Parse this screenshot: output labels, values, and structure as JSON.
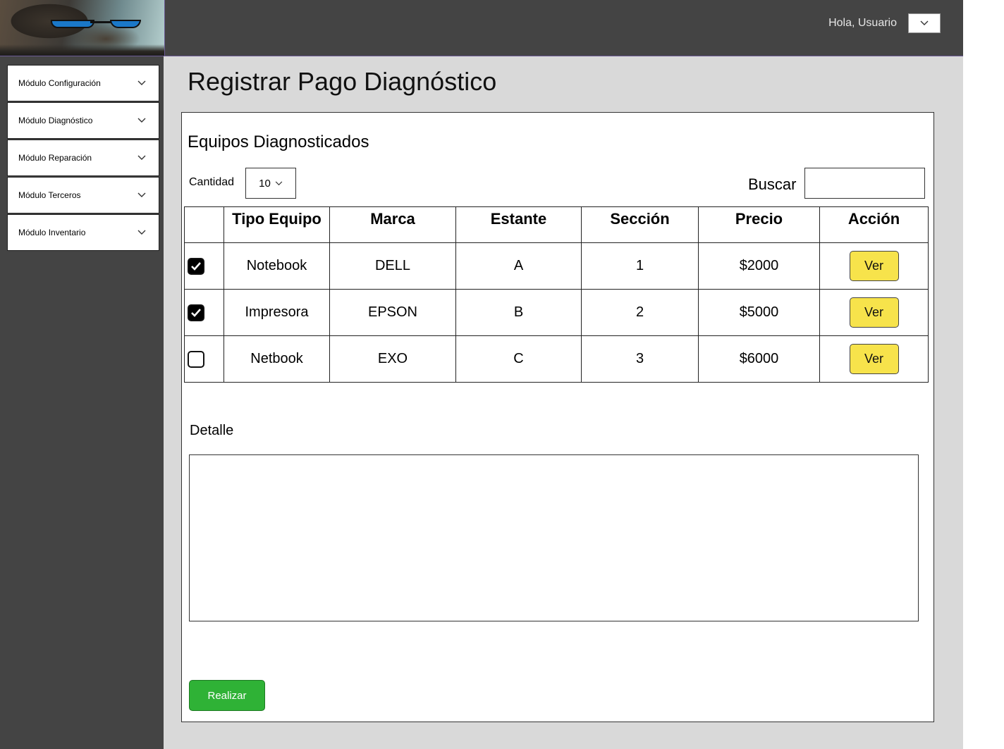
{
  "header": {
    "greeting": "Hola, Usuario"
  },
  "sidebar": {
    "items": [
      {
        "label": "Módulo Configuración"
      },
      {
        "label": "Módulo Diagnóstico"
      },
      {
        "label": "Módulo Reparación"
      },
      {
        "label": "Módulo Terceros"
      },
      {
        "label": "Módulo Inventario"
      }
    ]
  },
  "main": {
    "title": "Registrar Pago Diagnóstico",
    "section_title": "Equipos Diagnosticados",
    "quantity_label": "Cantidad",
    "quantity_value": "10",
    "search_label": "Buscar",
    "search_value": "",
    "table": {
      "headers": [
        "",
        "Tipo Equipo",
        "Marca",
        "Estante",
        "Sección",
        "Precio",
        "Acción"
      ],
      "rows": [
        {
          "checked": true,
          "tipo": "Notebook",
          "marca": "DELL",
          "estante": "A",
          "seccion": "1",
          "precio": "$2000",
          "accion": "Ver"
        },
        {
          "checked": true,
          "tipo": "Impresora",
          "marca": "EPSON",
          "estante": "B",
          "seccion": "2",
          "precio": "$5000",
          "accion": "Ver"
        },
        {
          "checked": false,
          "tipo": "Netbook",
          "marca": "EXO",
          "estante": "C",
          "seccion": "3",
          "precio": "$6000",
          "accion": "Ver"
        }
      ]
    },
    "detail_label": "Detalle",
    "detail_value": "",
    "submit_label": "Realizar"
  },
  "colors": {
    "topbar": "#444444",
    "content_bg": "#d9d9d9",
    "view_button": "#f7e34b",
    "submit_button": "#2fb236"
  },
  "icons": {
    "dropdown": "chevron-down-icon",
    "checkbox_checked": "checkmark-icon"
  }
}
